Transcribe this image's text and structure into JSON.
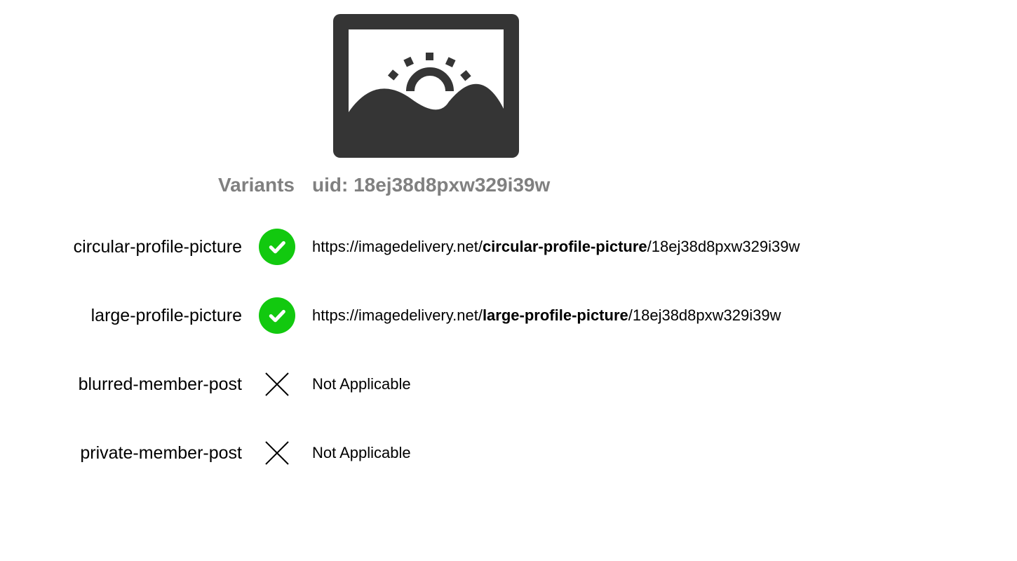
{
  "header": {
    "variants_label": "Variants",
    "uid_label": "uid: 18ej38d8pxw329i39w"
  },
  "url_base": "https://imagedelivery.net/",
  "uid": "18ej38d8pxw329i39w",
  "na_text": "Not Applicable",
  "variants": [
    {
      "name": "circular-profile-picture",
      "status": "ok"
    },
    {
      "name": "large-profile-picture",
      "status": "ok"
    },
    {
      "name": "blurred-member-post",
      "status": "na"
    },
    {
      "name": "private-member-post",
      "status": "na"
    }
  ]
}
